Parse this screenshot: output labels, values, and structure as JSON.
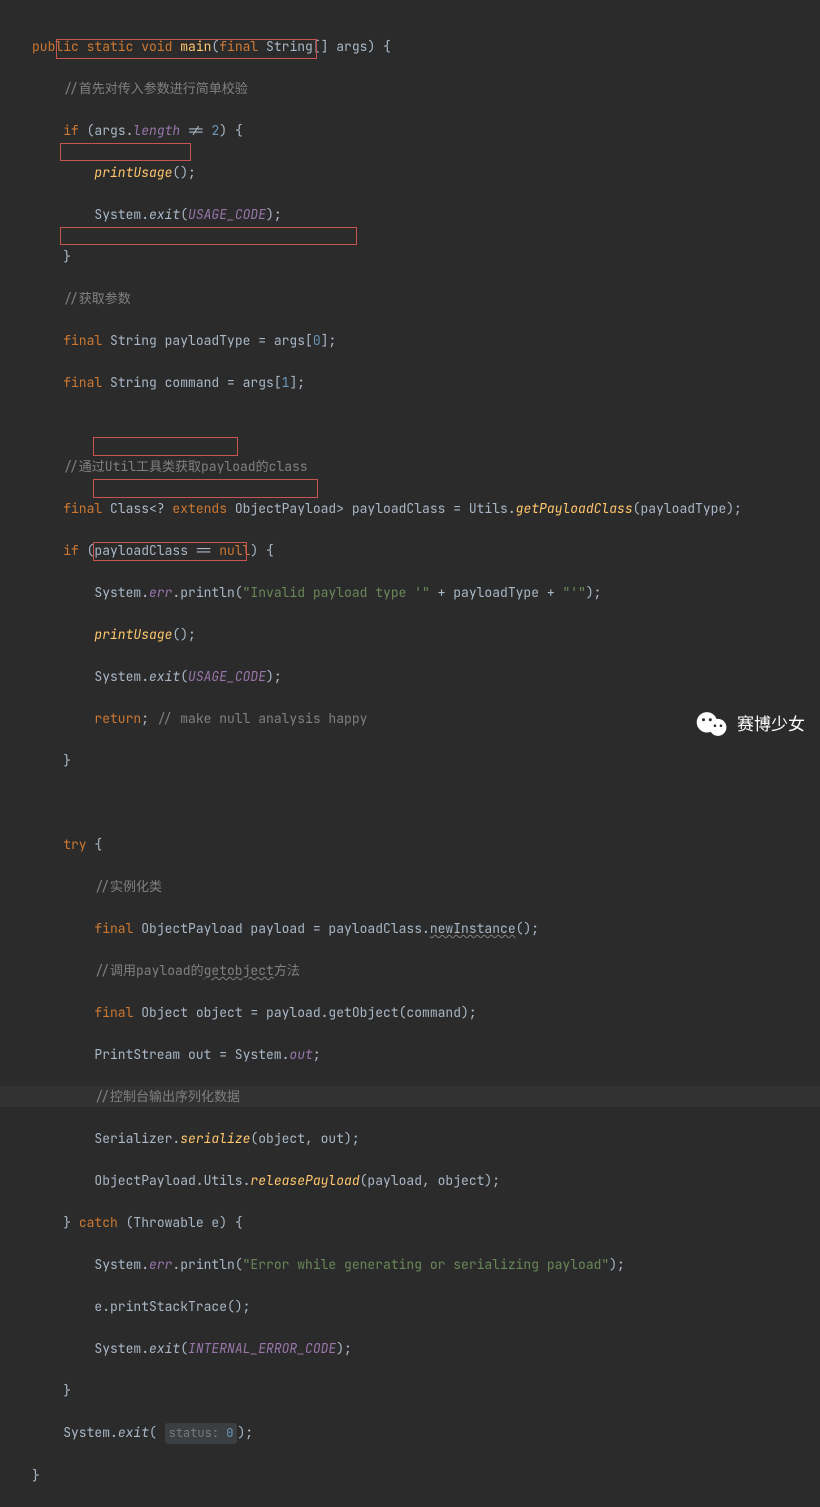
{
  "lines": {
    "l1_mod": "public static void",
    "l1_fn": "main",
    "l1_kw": "final",
    "l1_rest": " String[] args) {",
    "c1": "//首先对传入参数进行简单校验",
    "l2_kw": "if",
    "l2_a": " (args.",
    "l2_len": "length",
    "l2_b": " != ",
    "l2_n": "2",
    "l2_c": ") {",
    "l3_fn": "printUsage",
    "l3_a": "();",
    "l4_a": "System.",
    "l4_fn": "exit",
    "l4_b": "(",
    "l4_cn": "USAGE_CODE",
    "l4_c": ");",
    "l5": "}",
    "c2": "//获取参数",
    "l6_kw": "final",
    "l6_a": " String payloadType = args[",
    "l6_n": "0",
    "l6_b": "];",
    "l7_kw": "final",
    "l7_a": " String command = args[",
    "l7_n": "1",
    "l7_b": "];",
    "c3": "//通过Util工具类获取payload的class",
    "l8_kw": "final",
    "l8_a": " Class<? ",
    "l8_ext": "extends",
    "l8_b": " ObjectPayload> payloadClass = Utils.",
    "l8_fn": "getPayloadClass",
    "l8_c": "(payloadType);",
    "l9_kw": "if",
    "l9_a": " (payloadClass == ",
    "l9_nl": "null",
    "l9_b": ") {",
    "l10_a": "System.",
    "l10_err": "err",
    "l10_b": ".println(",
    "l10_s1": "\"Invalid payload type '\"",
    "l10_c": " + payloadType + ",
    "l10_s2": "\"'\"",
    "l10_d": ");",
    "l11_fn": "printUsage",
    "l11_a": "();",
    "l12_a": "System.",
    "l12_fn": "exit",
    "l12_b": "(",
    "l12_cn": "USAGE_CODE",
    "l12_c": ");",
    "l13_kw": "return",
    "l13_a": ";",
    "l13_cm": " // make null analysis happy",
    "l14": "}",
    "l15_kw": "try",
    "l15_a": " {",
    "c4": "//实例化类",
    "l16_kw": "final",
    "l16_a": " ObjectPayload payload = payloadClass.",
    "l16_fn": "newInstance",
    "l16_b": "();",
    "c5_a": "//调用payload的",
    "c5_b": "getobject",
    "c5_c": "方法",
    "l17_kw": "final",
    "l17_a": " Object object = payload.getObject(command);",
    "l18_a": "PrintStream out = System.",
    "l18_cn": "out",
    "l18_b": ";",
    "c6": "//控制台输出序列化数据",
    "l19_a": "Serializer.",
    "l19_fn": "serialize",
    "l19_b": "(object, out);",
    "l20_a": "ObjectPayload.Utils.",
    "l20_fn": "releasePayload",
    "l20_b": "(payload, object);",
    "l21_a": "} ",
    "l21_kw": "catch",
    "l21_b": " (Throwable e) {",
    "l22_a": "System.",
    "l22_err": "err",
    "l22_b": ".println(",
    "l22_s": "\"Error while generating or serializing payload\"",
    "l22_c": ");",
    "l23_a": "e.printStackTrace();",
    "l24_a": "System.",
    "l24_fn": "exit",
    "l24_b": "(",
    "l24_cn": "INTERNAL_ERROR_CODE",
    "l24_c": ");",
    "l25": "}",
    "l26_a": "System.",
    "l26_fn": "exit",
    "l26_b": "( ",
    "l26_pill_k": "status:",
    "l26_pill_v": "0",
    "l26_c": ");",
    "l27": "}"
  },
  "watermark": "赛博少女"
}
